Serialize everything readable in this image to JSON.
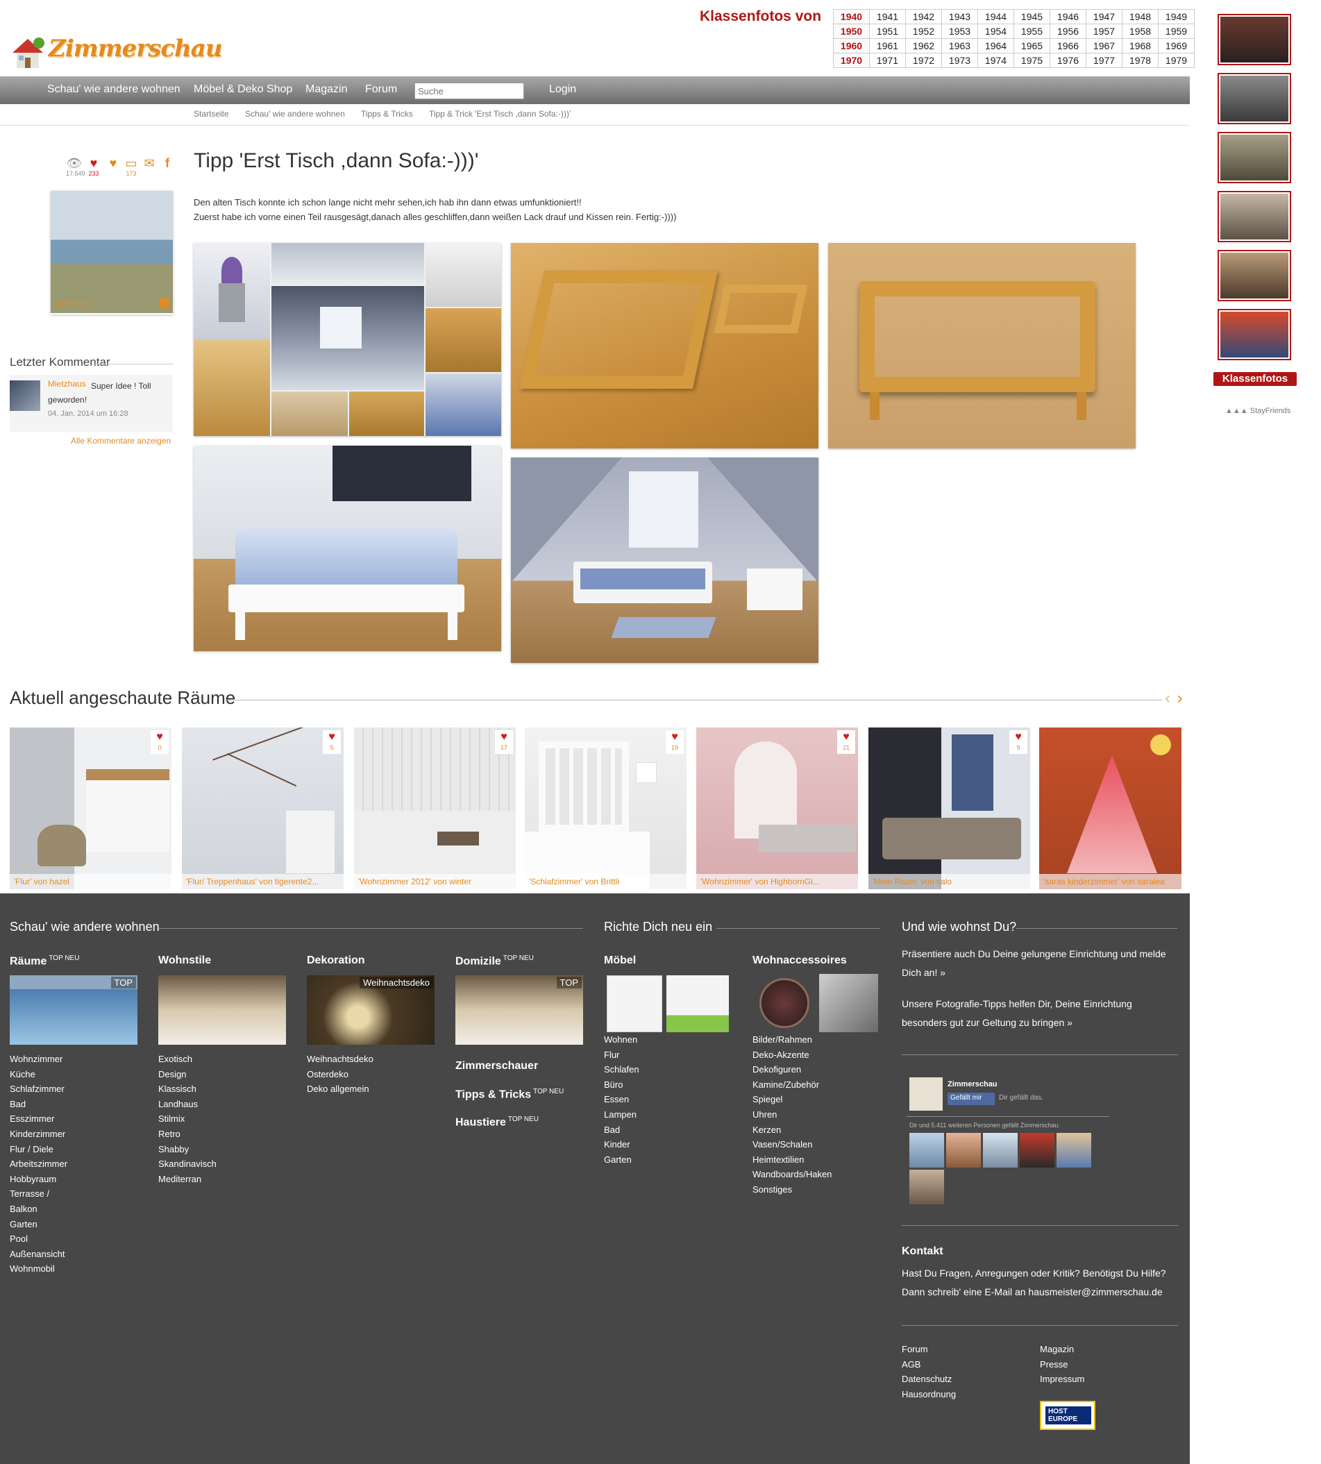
{
  "header": {
    "logo_text": "Zimmerschau",
    "klassenfotos_title": "Klassenfotos von",
    "year_rows": [
      [
        "1940",
        "1941",
        "1942",
        "1943",
        "1944",
        "1945",
        "1946",
        "1947",
        "1948",
        "1949"
      ],
      [
        "1950",
        "1951",
        "1952",
        "1953",
        "1954",
        "1955",
        "1956",
        "1957",
        "1958",
        "1959"
      ],
      [
        "1960",
        "1961",
        "1962",
        "1963",
        "1964",
        "1965",
        "1966",
        "1967",
        "1968",
        "1969"
      ],
      [
        "1970",
        "1971",
        "1972",
        "1973",
        "1974",
        "1975",
        "1976",
        "1977",
        "1978",
        "1979"
      ]
    ]
  },
  "nav": {
    "items": [
      "Schau' wie andere wohnen",
      "Möbel & Deko Shop",
      "Magazin",
      "Forum"
    ],
    "search_placeholder": "Suche",
    "login": "Login"
  },
  "breadcrumb": [
    "Startseite",
    "Schau' wie andere wohnen",
    "Tipps & Tricks",
    "Tipp & Trick 'Erst Tisch ,dann Sofa:-)))'"
  ],
  "stats": {
    "views": "17.549",
    "likes": "233",
    "comments": "173"
  },
  "profile": {
    "name": "grandhasi"
  },
  "last_comment": {
    "title": "Letzter Kommentar",
    "user": "Mietzhaus",
    "text": "Super Idee ! Toll geworden!",
    "date": "04. Jan. 2014 um 16:28",
    "all_link": "Alle Kommentare anzeigen"
  },
  "post": {
    "title": "Tipp 'Erst Tisch ,dann Sofa:-)))'",
    "desc_line1": "Den alten Tisch konnte ich schon lange nicht mehr sehen,ich hab ihn dann etwas umfunktioniert!!",
    "desc_line2": "Zuerst habe ich vorne einen Teil rausgesägt,danach alles geschliffen,dann weißen Lack drauf und Kissen rein. Fertig:-))))"
  },
  "recent": {
    "title": "Aktuell angeschaute Räume",
    "items": [
      {
        "caption": "'Flur' von hazel",
        "likes": "0"
      },
      {
        "caption": "'Flur/ Treppenhaus' von tigerente2...",
        "likes": "5"
      },
      {
        "caption": "'Wohnzimmer 2012' von winter",
        "likes": "17"
      },
      {
        "caption": "'Schlafzimmer' von Brittli",
        "likes": "19"
      },
      {
        "caption": "'Wohnzimmer' von HighbornGi...",
        "likes": "21"
      },
      {
        "caption": "'Mein Raum' von salo",
        "likes": "9"
      },
      {
        "caption": "'saras kinderzimmer' von saralea",
        "likes": ""
      }
    ]
  },
  "sidebar": {
    "button": "Klassenfotos",
    "stayfriends": "StayFriends"
  },
  "footer": {
    "col1_title": "Schau' wie andere wohnen",
    "col2_title": "Richte Dich neu ein",
    "col3_title": "Und wie wohnst Du?",
    "raeume": {
      "title": "Räume",
      "sup": "TOP NEU",
      "tag": "TOP",
      "items": [
        "Wohnzimmer",
        "Küche",
        "Schlafzimmer",
        "Bad",
        "Esszimmer",
        "Kinderzimmer",
        "Flur / Diele",
        "Arbeitszimmer",
        "Hobbyraum",
        "Terrasse /",
        "Balkon",
        "Garten",
        "Pool",
        "Außenansicht",
        "Wohnmobil"
      ]
    },
    "wohnstile": {
      "title": "Wohnstile",
      "items": [
        "Exotisch",
        "Design",
        "Klassisch",
        "Landhaus",
        "Stilmix",
        "Retro",
        "Shabby",
        "Skandinavisch",
        "Mediterran"
      ]
    },
    "dekoration": {
      "title": "Dekoration",
      "tag": "Weihnachtsdeko",
      "items": [
        "Weihnachtsdeko",
        "Osterdeko",
        "Deko allgemein"
      ]
    },
    "domizile": {
      "title": "Domizile",
      "sup": "TOP NEU",
      "tag": "TOP"
    },
    "zimmerschauer": "Zimmerschauer",
    "tipps": {
      "title": "Tipps & Tricks",
      "sup": "TOP NEU"
    },
    "haustiere": {
      "title": "Haustiere",
      "sup": "TOP NEU"
    },
    "moebel": {
      "title": "Möbel",
      "items": [
        "Wohnen",
        "Flur",
        "Schlafen",
        "Büro",
        "Essen",
        "Lampen",
        "Bad",
        "Kinder",
        "Garten"
      ]
    },
    "wohnacc": {
      "title": "Wohnaccessoires",
      "items": [
        "Bilder/Rahmen",
        "Deko-Akzente",
        "Dekofiguren",
        "Kamine/Zubehör",
        "Spiegel",
        "Uhren",
        "Kerzen",
        "Vasen/Schalen",
        "Heimtextilien",
        "Wandboards/Haken",
        "Sonstiges"
      ]
    },
    "praesentiere": "Präsentiere auch Du Deine gelungene Einrichtung und melde Dich an! »",
    "foto_tipps": "Unsere Fotografie-Tipps helfen Dir, Deine Einrichtung besonders gut zur Geltung zu bringen »",
    "fb": {
      "name": "Zimmerschau",
      "button": "Gefällt mir",
      "liked": "Dir gefällt das.",
      "count": "Dir und 5.411 weiteren Personen gefällt Zimmerschau."
    },
    "kontakt_title": "Kontakt",
    "kontakt_text": "Hast Du Fragen, Anregungen oder Kritik? Benötigst Du Hilfe? Dann schreib' eine E-Mail an hausmeister@zimmerschau.de",
    "links_left": [
      "Forum",
      "AGB",
      "Datenschutz",
      "Hausordnung"
    ],
    "links_right": [
      "Magazin",
      "Presse",
      "Impressum"
    ],
    "host_badge": "HOST EUROPE"
  }
}
